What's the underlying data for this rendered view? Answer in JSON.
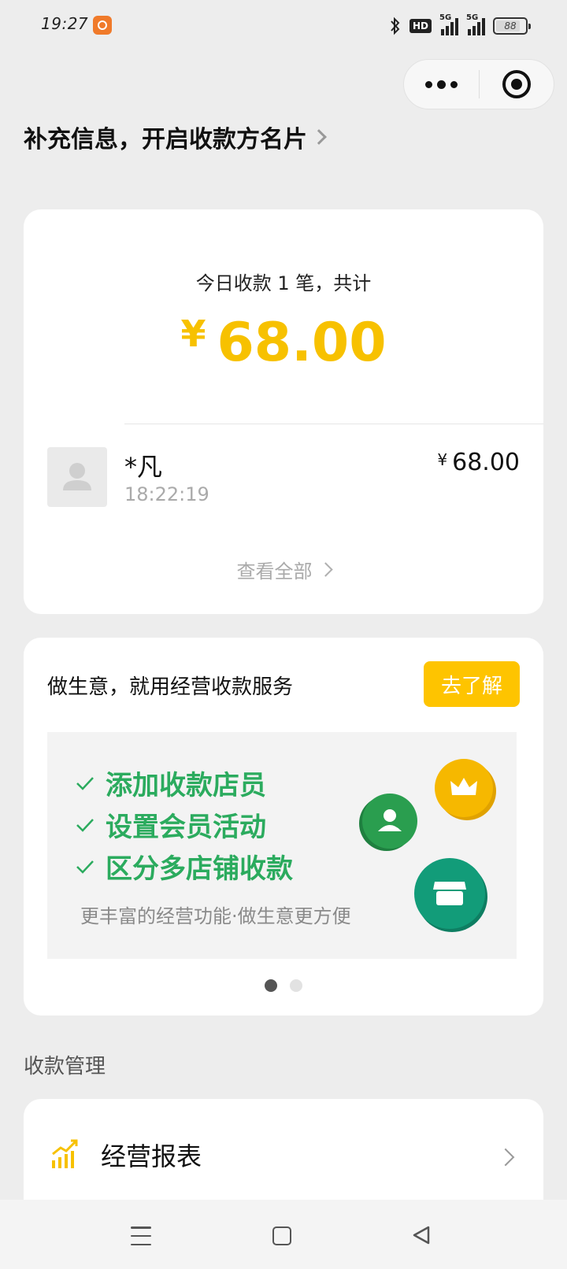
{
  "status_bar": {
    "time": "19:27",
    "network_type": "5G",
    "hd_label": "HD",
    "battery_level": "88"
  },
  "capsule": {
    "more_icon": "more-dots-icon",
    "close_icon": "target-close-icon"
  },
  "header": {
    "link_text": "补充信息，开启收款方名片"
  },
  "today_card": {
    "summary_label": "今日收款 1 笔，共计",
    "currency_symbol": "¥",
    "total_amount": "68.00",
    "transaction": {
      "payer_name": "*凡",
      "time": "18:22:19",
      "amount": "68.00"
    },
    "view_all_label": "查看全部"
  },
  "business_card": {
    "title": "做生意，就用经营收款服务",
    "button_label": "去了解",
    "features": [
      "添加收款店员",
      "设置会员活动",
      "区分多店铺收款"
    ],
    "subtitle": "更丰富的经营功能·做生意更方便",
    "carousel_pages": 2,
    "carousel_active_index": 0
  },
  "management": {
    "section_label": "收款管理",
    "items": [
      {
        "label": "经营报表",
        "icon": "bar-chart-trend-icon"
      }
    ]
  },
  "colors": {
    "accent_yellow": "#fec400",
    "amount_yellow": "#f7c100",
    "feature_green": "#2bab5e",
    "background": "#ededed"
  }
}
